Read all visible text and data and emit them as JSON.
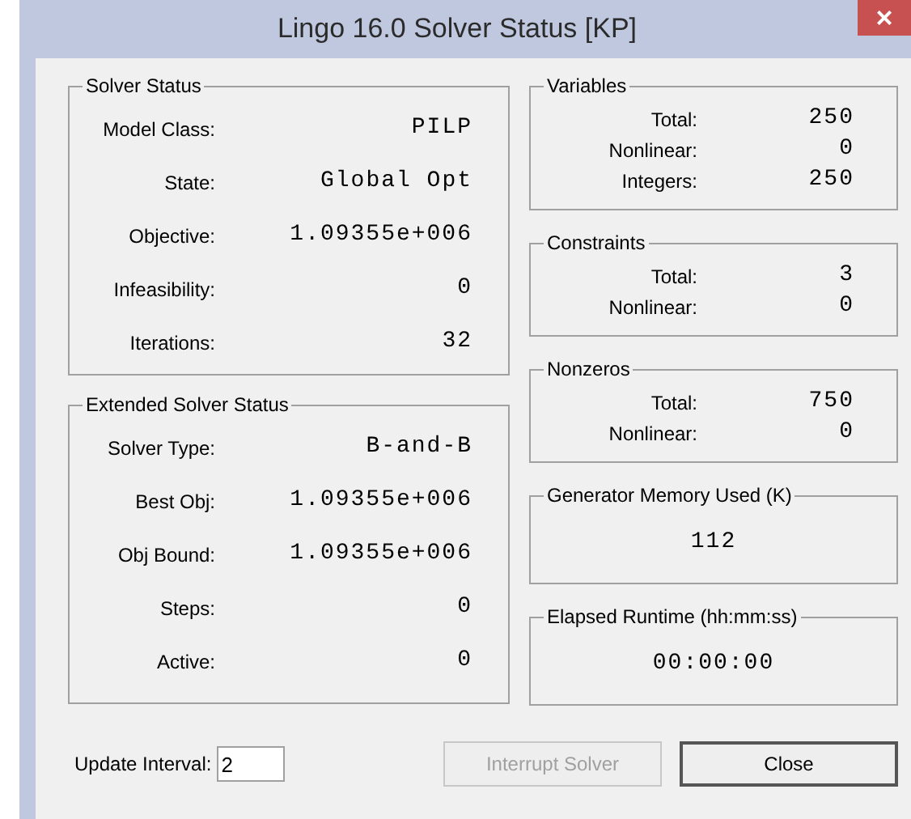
{
  "window": {
    "title": "Lingo 16.0 Solver Status [KP]",
    "close": "×"
  },
  "left_groups": [
    {
      "title": "Solver Status",
      "rows": [
        {
          "label": "Model Class:",
          "value": "PILP"
        },
        {
          "label": "State:",
          "value": "Global Opt"
        },
        {
          "label": "Objective:",
          "value": "1.09355e+006"
        },
        {
          "label": "Infeasibility:",
          "value": "0"
        },
        {
          "label": "Iterations:",
          "value": "32"
        }
      ]
    },
    {
      "title": "Extended Solver Status",
      "rows": [
        {
          "label": "Solver Type:",
          "value": "B-and-B"
        },
        {
          "label": "Best Obj:",
          "value": "1.09355e+006"
        },
        {
          "label": "Obj Bound:",
          "value": "1.09355e+006"
        },
        {
          "label": "Steps:",
          "value": "0"
        },
        {
          "label": "Active:",
          "value": "0"
        }
      ]
    }
  ],
  "right_groups": [
    {
      "kind": "table",
      "title": "Variables",
      "rows": [
        {
          "label": "Total:",
          "value": "250"
        },
        {
          "label": "Nonlinear:",
          "value": "0"
        },
        {
          "label": "Integers:",
          "value": "250"
        }
      ]
    },
    {
      "kind": "table",
      "title": "Constraints",
      "rows": [
        {
          "label": "Total:",
          "value": "3"
        },
        {
          "label": "Nonlinear:",
          "value": "0"
        }
      ]
    },
    {
      "kind": "table",
      "title": "Nonzeros",
      "rows": [
        {
          "label": "Total:",
          "value": "750"
        },
        {
          "label": "Nonlinear:",
          "value": "0"
        }
      ]
    },
    {
      "kind": "single",
      "title": "Generator Memory Used (K)",
      "value": "112"
    },
    {
      "kind": "single",
      "title": "Elapsed Runtime (hh:mm:ss)",
      "value": "00:00:00"
    }
  ],
  "update_interval": {
    "label": "Update Interval:",
    "value": "2"
  },
  "buttons": [
    {
      "label": "Interrupt Solver",
      "disabled": true,
      "default": false
    },
    {
      "label": "Close",
      "disabled": false,
      "default": true
    }
  ]
}
